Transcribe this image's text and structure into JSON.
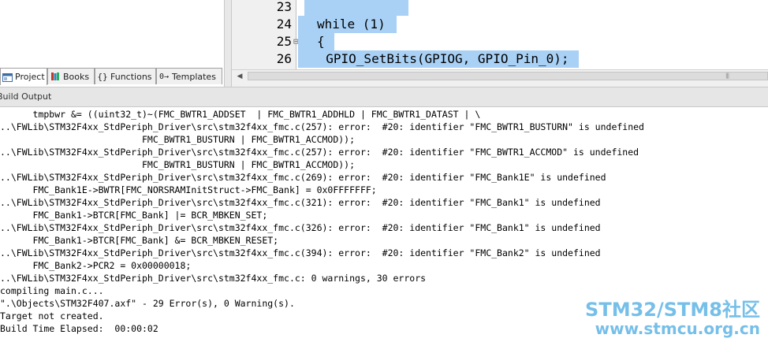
{
  "editor": {
    "lines": [
      {
        "num": "23",
        "fold": "",
        "code": ""
      },
      {
        "num": "24",
        "fold": "",
        "code": "while (1)"
      },
      {
        "num": "25",
        "fold": "⊟",
        "code": "{"
      },
      {
        "num": "26",
        "fold": "",
        "code": "  GPIO_SetBits(GPIOG, GPIO_Pin_0);"
      }
    ],
    "selection_color": "#a9d1f5"
  },
  "project_tabs": [
    {
      "label": "Project",
      "icon": "project-icon",
      "active": true
    },
    {
      "label": "Books",
      "icon": "books-icon",
      "active": false
    },
    {
      "label": "Functions",
      "icon": "functions-icon",
      "active": false
    },
    {
      "label": "Templates",
      "icon": "templates-icon",
      "active": false
    }
  ],
  "build_output": {
    "title": "Build Output",
    "lines": [
      "      tmpbwr &= ((uint32_t)~(FMC_BWTR1_ADDSET  | FMC_BWTR1_ADDHLD | FMC_BWTR1_DATAST | \\",
      "..\\FWLib\\STM32F4xx_StdPeriph_Driver\\src\\stm32f4xx_fmc.c(257): error:  #20: identifier \"FMC_BWTR1_BUSTURN\" is undefined",
      "                          FMC_BWTR1_BUSTURN | FMC_BWTR1_ACCMOD));",
      "..\\FWLib\\STM32F4xx_StdPeriph_Driver\\src\\stm32f4xx_fmc.c(257): error:  #20: identifier \"FMC_BWTR1_ACCMOD\" is undefined",
      "                          FMC_BWTR1_BUSTURN | FMC_BWTR1_ACCMOD));",
      "..\\FWLib\\STM32F4xx_StdPeriph_Driver\\src\\stm32f4xx_fmc.c(269): error:  #20: identifier \"FMC_Bank1E\" is undefined",
      "      FMC_Bank1E->BWTR[FMC_NORSRAMInitStruct->FMC_Bank] = 0x0FFFFFFF;",
      "..\\FWLib\\STM32F4xx_StdPeriph_Driver\\src\\stm32f4xx_fmc.c(321): error:  #20: identifier \"FMC_Bank1\" is undefined",
      "      FMC_Bank1->BTCR[FMC_Bank] |= BCR_MBKEN_SET;",
      "..\\FWLib\\STM32F4xx_StdPeriph_Driver\\src\\stm32f4xx_fmc.c(326): error:  #20: identifier \"FMC_Bank1\" is undefined",
      "      FMC_Bank1->BTCR[FMC_Bank] &= BCR_MBKEN_RESET;",
      "..\\FWLib\\STM32F4xx_StdPeriph_Driver\\src\\stm32f4xx_fmc.c(394): error:  #20: identifier \"FMC_Bank2\" is undefined",
      "      FMC_Bank2->PCR2 = 0x00000018;",
      "..\\FWLib\\STM32F4xx_StdPeriph_Driver\\src\\stm32f4xx_fmc.c: 0 warnings, 30 errors",
      "compiling main.c...",
      "\".\\Objects\\STM32F407.axf\" - 29 Error(s), 0 Warning(s).",
      "Target not created.",
      "Build Time Elapsed:  00:00:02"
    ]
  },
  "watermark": {
    "line1": "STM32/STM8社区",
    "line2": "www.stmcu.org.cn"
  },
  "scrollbar": {
    "left_arrow": "◀"
  }
}
